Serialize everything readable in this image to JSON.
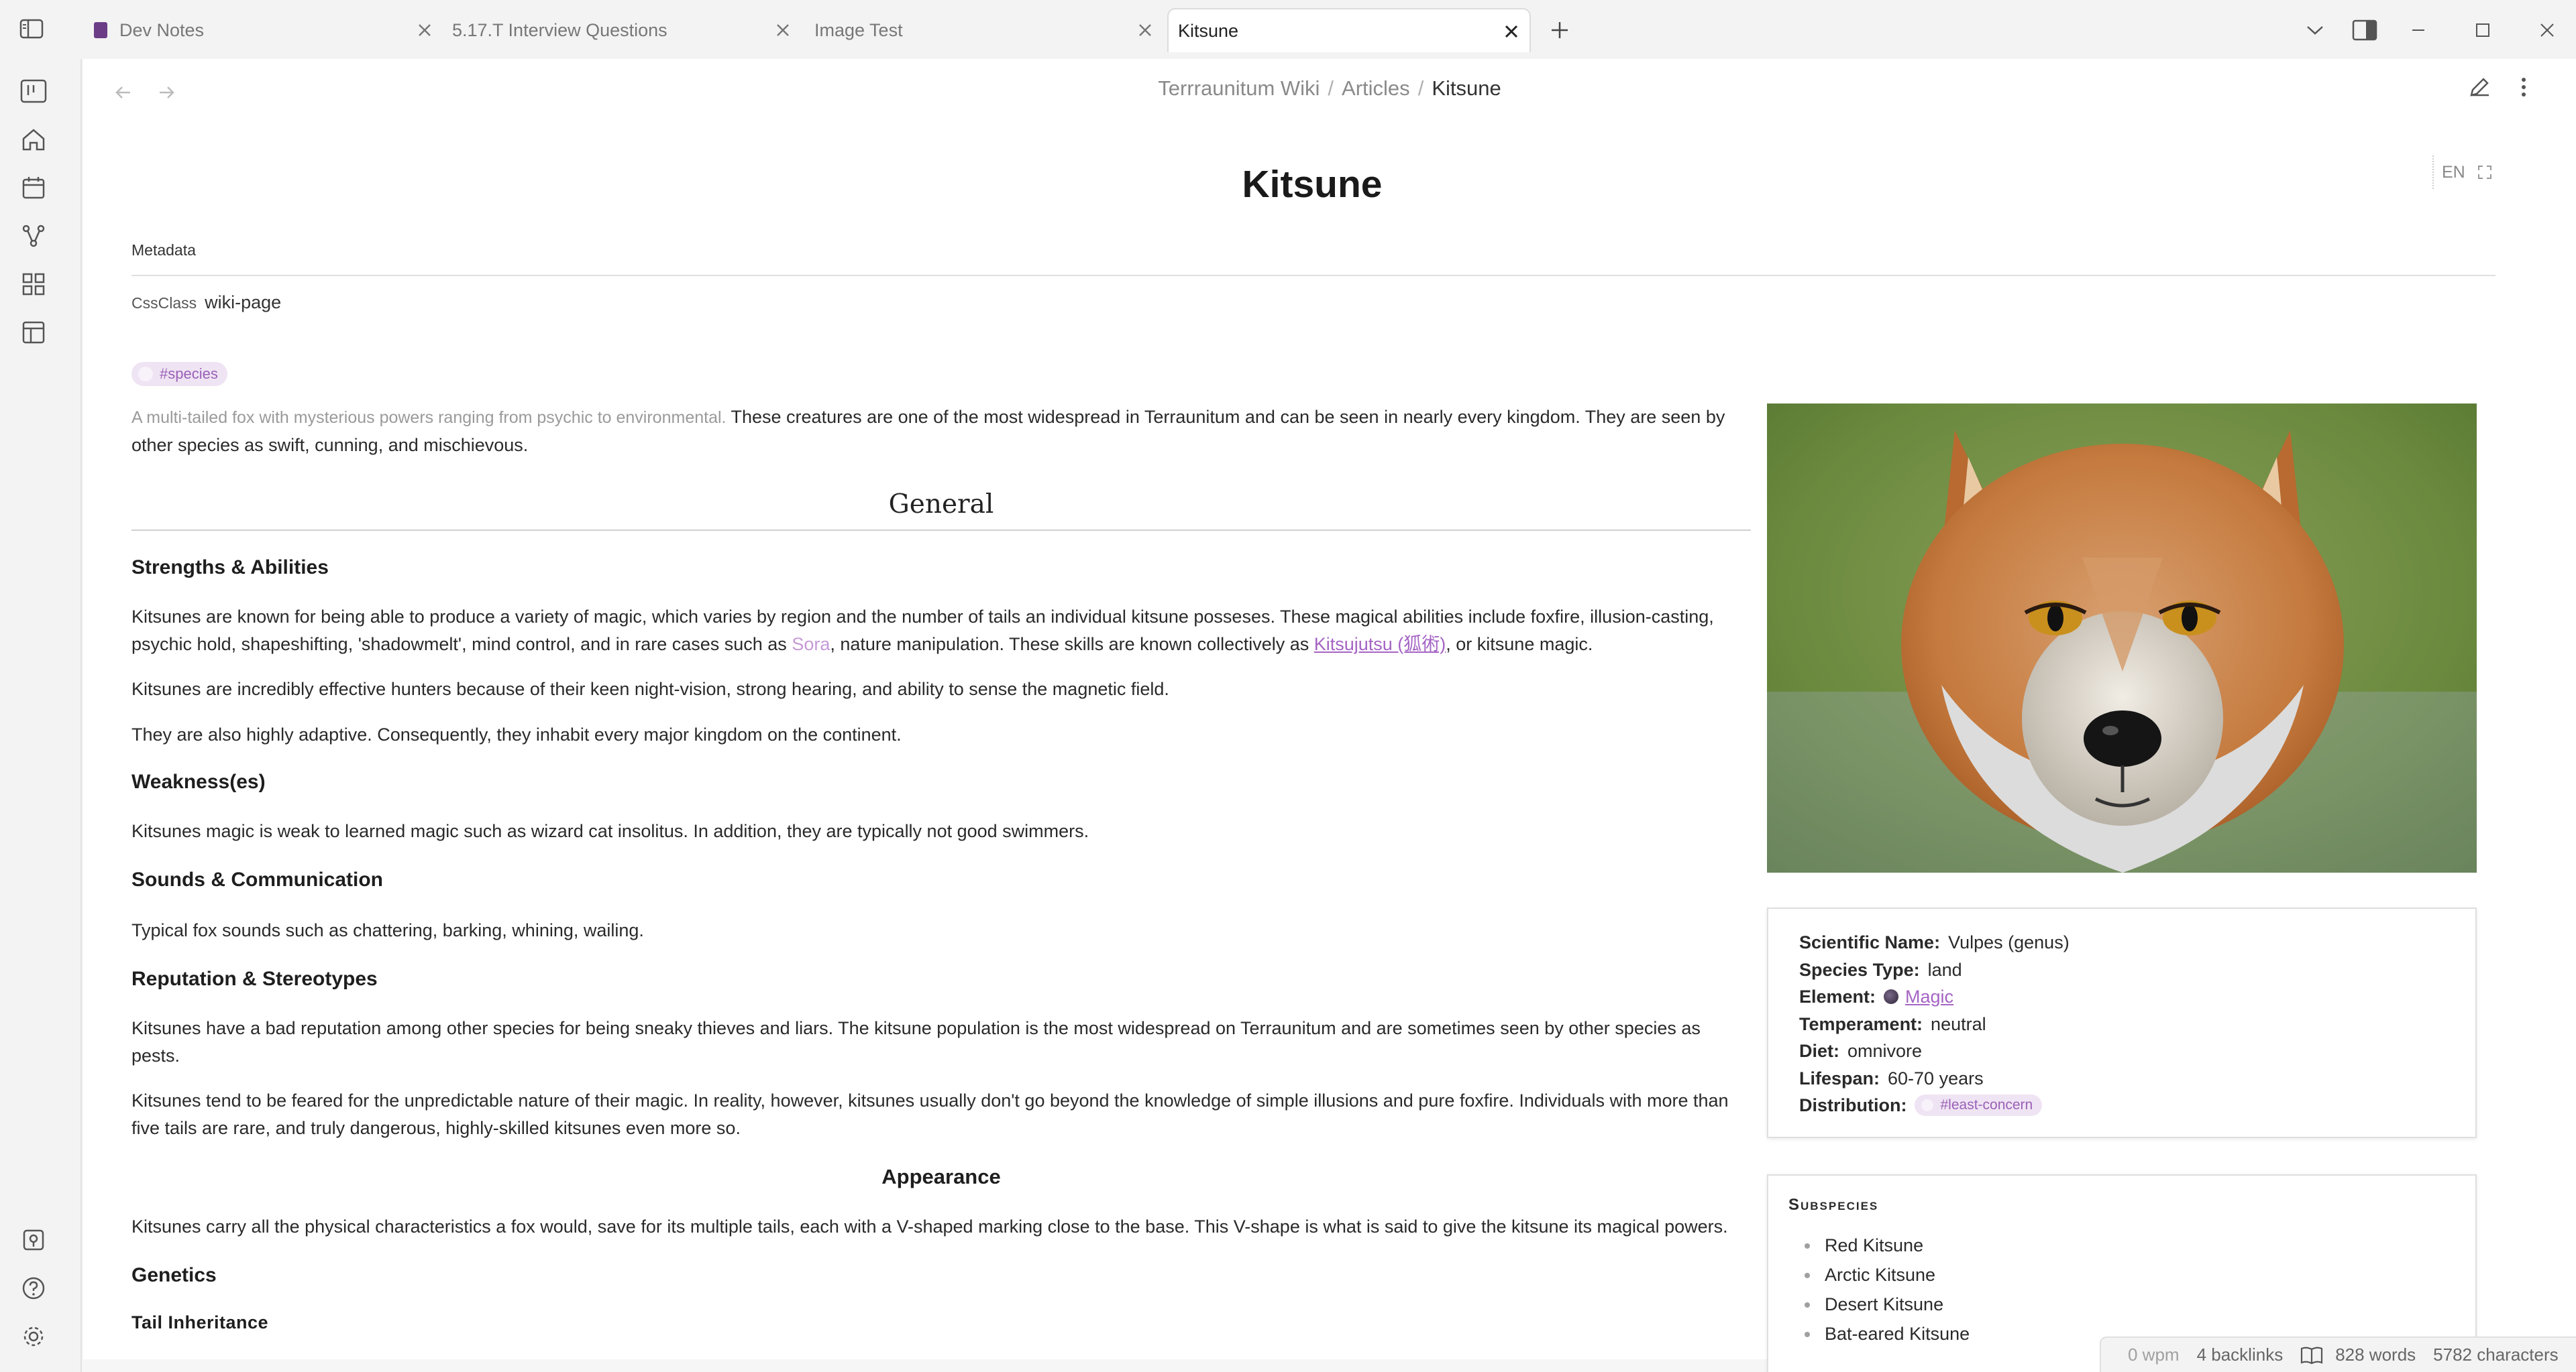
{
  "tabs": [
    {
      "label": "Dev Notes",
      "active": false
    },
    {
      "label": "5.17.T Interview Questions",
      "active": false
    },
    {
      "label": "Image Test",
      "active": false
    },
    {
      "label": "Kitsune",
      "active": true
    }
  ],
  "ribbon_icons": [
    "sidebar-toggle-icon",
    "kanban-icon",
    "home-icon",
    "calendar-icon",
    "graph-icon",
    "dashboard-icon",
    "layout-icon",
    "vault-icon",
    "help-icon",
    "settings-icon"
  ],
  "breadcrumb": {
    "root": "Terrraunitum Wiki",
    "section": "Articles",
    "current": "Kitsune",
    "sep": "/"
  },
  "lang": "EN",
  "article": {
    "title": "Kitsune",
    "metadata_label": "Metadata",
    "cssclass_key": "CssClass",
    "cssclass_value": "wiki-page",
    "species_tag": "#species",
    "intro_muted": "A multi-tailed fox with mysterious powers ranging from psychic to environmental.",
    "intro_line1": " These creatures are one of the most widespread in Terraunitum and can be seen in nearly every kingdom. They are seen by",
    "intro_line2": "other species as swift, cunning, and mischievous.",
    "general_heading": "General",
    "strengths_heading": "Strengths & Abilities",
    "strengths_p1_a": "Kitsunes are known for being able to produce a variety of magic, which varies by region and the number of tails an individual kitsune posseses. These magical abilities include foxfire, illusion-casting,",
    "strengths_p1_b": "psychic hold, shapeshifting, 'shadowmelt', mind control, and in rare cases such as ",
    "strengths_p1_sora": "Sora",
    "strengths_p1_c": ", nature manipulation. These skills are known collectively as ",
    "strengths_p1_link": "Kitsujutsu (狐術)",
    "strengths_p1_d": ", or kitsune magic.",
    "strengths_p2": "Kitsunes are incredibly effective hunters because of their keen night-vision, strong hearing, and ability to sense the magnetic field.",
    "strengths_p3": "They are also highly adaptive. Consequently, they inhabit every major kingdom on the continent.",
    "weakness_heading": "Weakness(es)",
    "weakness_p": "Kitsunes magic is weak to learned magic such as wizard cat insolitus. In addition, they are typically not good swimmers.",
    "sounds_heading": "Sounds & Communication",
    "sounds_p": "Typical fox sounds such as chattering, barking, whining, wailing.",
    "reputation_heading": "Reputation & Stereotypes",
    "reputation_p1_a": "Kitsunes have a bad reputation among other species for being sneaky thieves and liars. The kitsune population is the most widespread on Terraunitum and are sometimes seen by other species as",
    "reputation_p1_b": "pests.",
    "reputation_p2_a": "Kitsunes tend to be feared for the unpredictable nature of their magic. In reality, however, kitsunes usually don't go beyond the knowledge of simple illusions and pure foxfire. Individuals with more than",
    "reputation_p2_b": "five tails are rare, and truly dangerous, highly-skilled kitsunes even more so.",
    "appearance_heading": "Appearance",
    "appearance_p": "Kitsunes carry all the physical characteristics a fox would, save for its multiple tails, each with a V-shaped marking close to the base. This V-shape is what is said to give the kitsune its magical powers.",
    "genetics_heading": "Genetics",
    "tail_heading": "Tail Inheritance"
  },
  "infobox": {
    "scientific_name_k": "Scientific Name:",
    "scientific_name_v": "Vulpes (genus)",
    "species_type_k": "Species Type:",
    "species_type_v": "land",
    "element_k": "Element:",
    "element_v": "Magic",
    "temperament_k": "Temperament:",
    "temperament_v": "neutral",
    "diet_k": "Diet:",
    "diet_v": "omnivore",
    "lifespan_k": "Lifespan:",
    "lifespan_v": "60-70 years",
    "distribution_k": "Distribution:",
    "distribution_v": "#least-concern"
  },
  "subspecies": {
    "title": "Subspecies",
    "items": [
      "Red Kitsune",
      "Arctic Kitsune",
      "Desert Kitsune",
      "Bat-eared Kitsune"
    ]
  },
  "status": {
    "wpm": "0 wpm",
    "backlinks": "4 backlinks",
    "words": "828 words",
    "chars": "5782 characters"
  },
  "colors": {
    "accent": "#a564c4",
    "tag_bg": "#efe4f3"
  }
}
